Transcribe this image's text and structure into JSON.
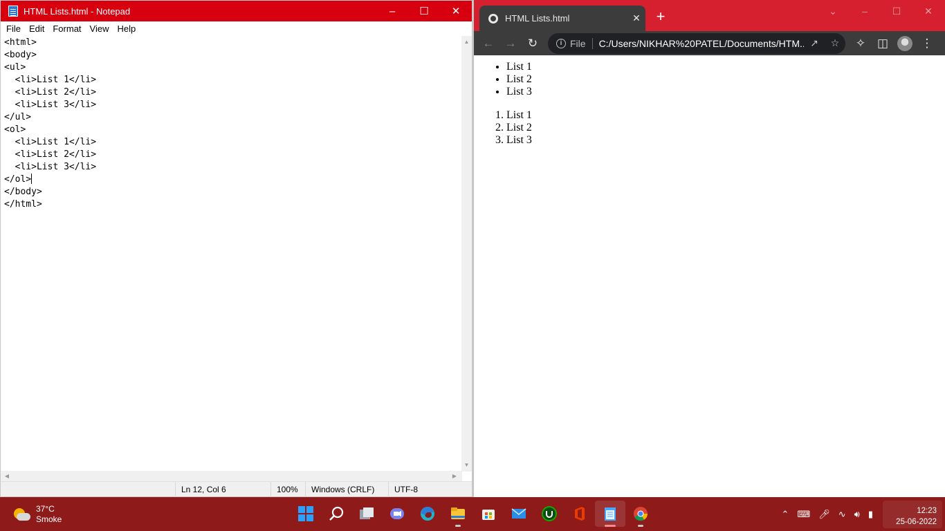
{
  "notepad": {
    "title": "HTML Lists.html - Notepad",
    "menu": [
      "File",
      "Edit",
      "Format",
      "View",
      "Help"
    ],
    "lines": [
      "<html>",
      "<body>",
      "<ul>",
      "  <li>List 1</li>",
      "  <li>List 2</li>",
      "  <li>List 3</li>",
      "</ul>",
      "<ol>",
      "  <li>List 1</li>",
      "  <li>List 2</li>",
      "  <li>List 3</li>",
      "</ol>",
      "</body>",
      "</html>"
    ],
    "status": {
      "position": "Ln 12, Col 6",
      "zoom": "100%",
      "line_ending": "Windows (CRLF)",
      "encoding": "UTF-8"
    }
  },
  "browser": {
    "tab_title": "HTML Lists.html",
    "scheme_label": "File",
    "url": "C:/Users/NIKHAR%20PATEL/Documents/HTM...",
    "unordered": [
      "List 1",
      "List 2",
      "List 3"
    ],
    "ordered": [
      "List 1",
      "List 2",
      "List 3"
    ]
  },
  "taskbar": {
    "temperature": "37°C",
    "condition": "Smoke",
    "time": "12:23",
    "date": "25-06-2022",
    "apps": [
      "start-icon",
      "search-icon",
      "task-view-icon",
      "teams-chat-icon",
      "edge-icon",
      "file-explorer-icon",
      "store-icon",
      "mail-icon",
      "upwork-icon",
      "office-icon",
      "notepad-icon",
      "chrome-icon"
    ]
  },
  "colors": {
    "notepad_titlebar": "#d7000f",
    "chrome_frame": "#d62030",
    "taskbar": "#8e1a1a"
  }
}
